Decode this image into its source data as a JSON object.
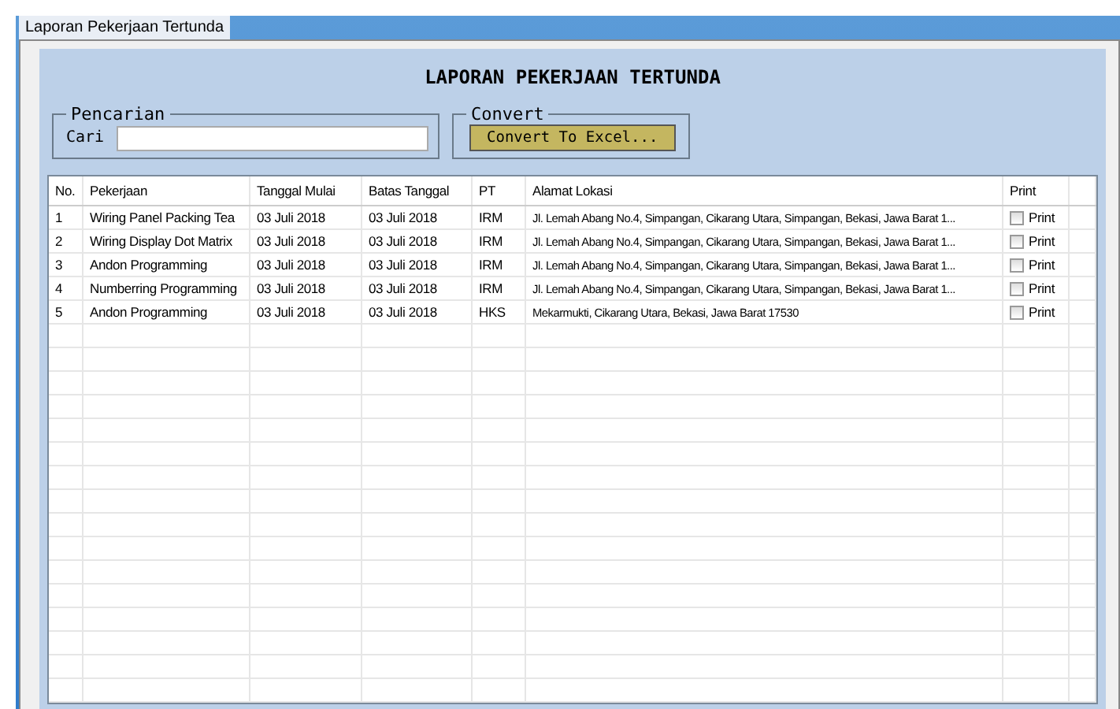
{
  "window": {
    "title": "Laporan Pekerjaan Tertunda"
  },
  "heading": "LAPORAN PEKERJAAN TERTUNDA",
  "search_group": {
    "legend": "Pencarian",
    "label": "Cari"
  },
  "convert_group": {
    "legend": "Convert",
    "button": "Convert To Excel..."
  },
  "table": {
    "columns": [
      "No.",
      "Pekerjaan",
      "Tanggal Mulai",
      "Batas Tanggal",
      "PT",
      "Alamat Lokasi",
      "Print"
    ],
    "rows": [
      {
        "no": "1",
        "pekerjaan": "Wiring Panel Packing Tea",
        "mulai": "03 Juli 2018",
        "batas": "03 Juli 2018",
        "pt": "IRM",
        "alamat": "Jl. Lemah Abang No.4, Simpangan, Cikarang Utara, Simpangan, Bekasi, Jawa Barat 1...",
        "print_label": "Print",
        "checked": false
      },
      {
        "no": "2",
        "pekerjaan": "Wiring Display Dot Matrix",
        "mulai": "03 Juli 2018",
        "batas": "03 Juli 2018",
        "pt": "IRM",
        "alamat": "Jl. Lemah Abang No.4, Simpangan, Cikarang Utara, Simpangan, Bekasi, Jawa Barat 1...",
        "print_label": "Print",
        "checked": false
      },
      {
        "no": "3",
        "pekerjaan": "Andon Programming",
        "mulai": "03 Juli 2018",
        "batas": "03 Juli 2018",
        "pt": "IRM",
        "alamat": "Jl. Lemah Abang No.4, Simpangan, Cikarang Utara, Simpangan, Bekasi, Jawa Barat 1...",
        "print_label": "Print",
        "checked": false
      },
      {
        "no": "4",
        "pekerjaan": "Numberring Programming",
        "mulai": "03 Juli 2018",
        "batas": "03 Juli 2018",
        "pt": "IRM",
        "alamat": "Jl. Lemah Abang No.4, Simpangan, Cikarang Utara, Simpangan, Bekasi, Jawa Barat 1...",
        "print_label": "Print",
        "checked": false
      },
      {
        "no": "5",
        "pekerjaan": "Andon Programming",
        "mulai": "03 Juli 2018",
        "batas": "03 Juli 2018",
        "pt": "HKS",
        "alamat": "Mekarmukti, Cikarang Utara, Bekasi, Jawa Barat 17530",
        "print_label": "Print",
        "checked": false
      }
    ]
  }
}
